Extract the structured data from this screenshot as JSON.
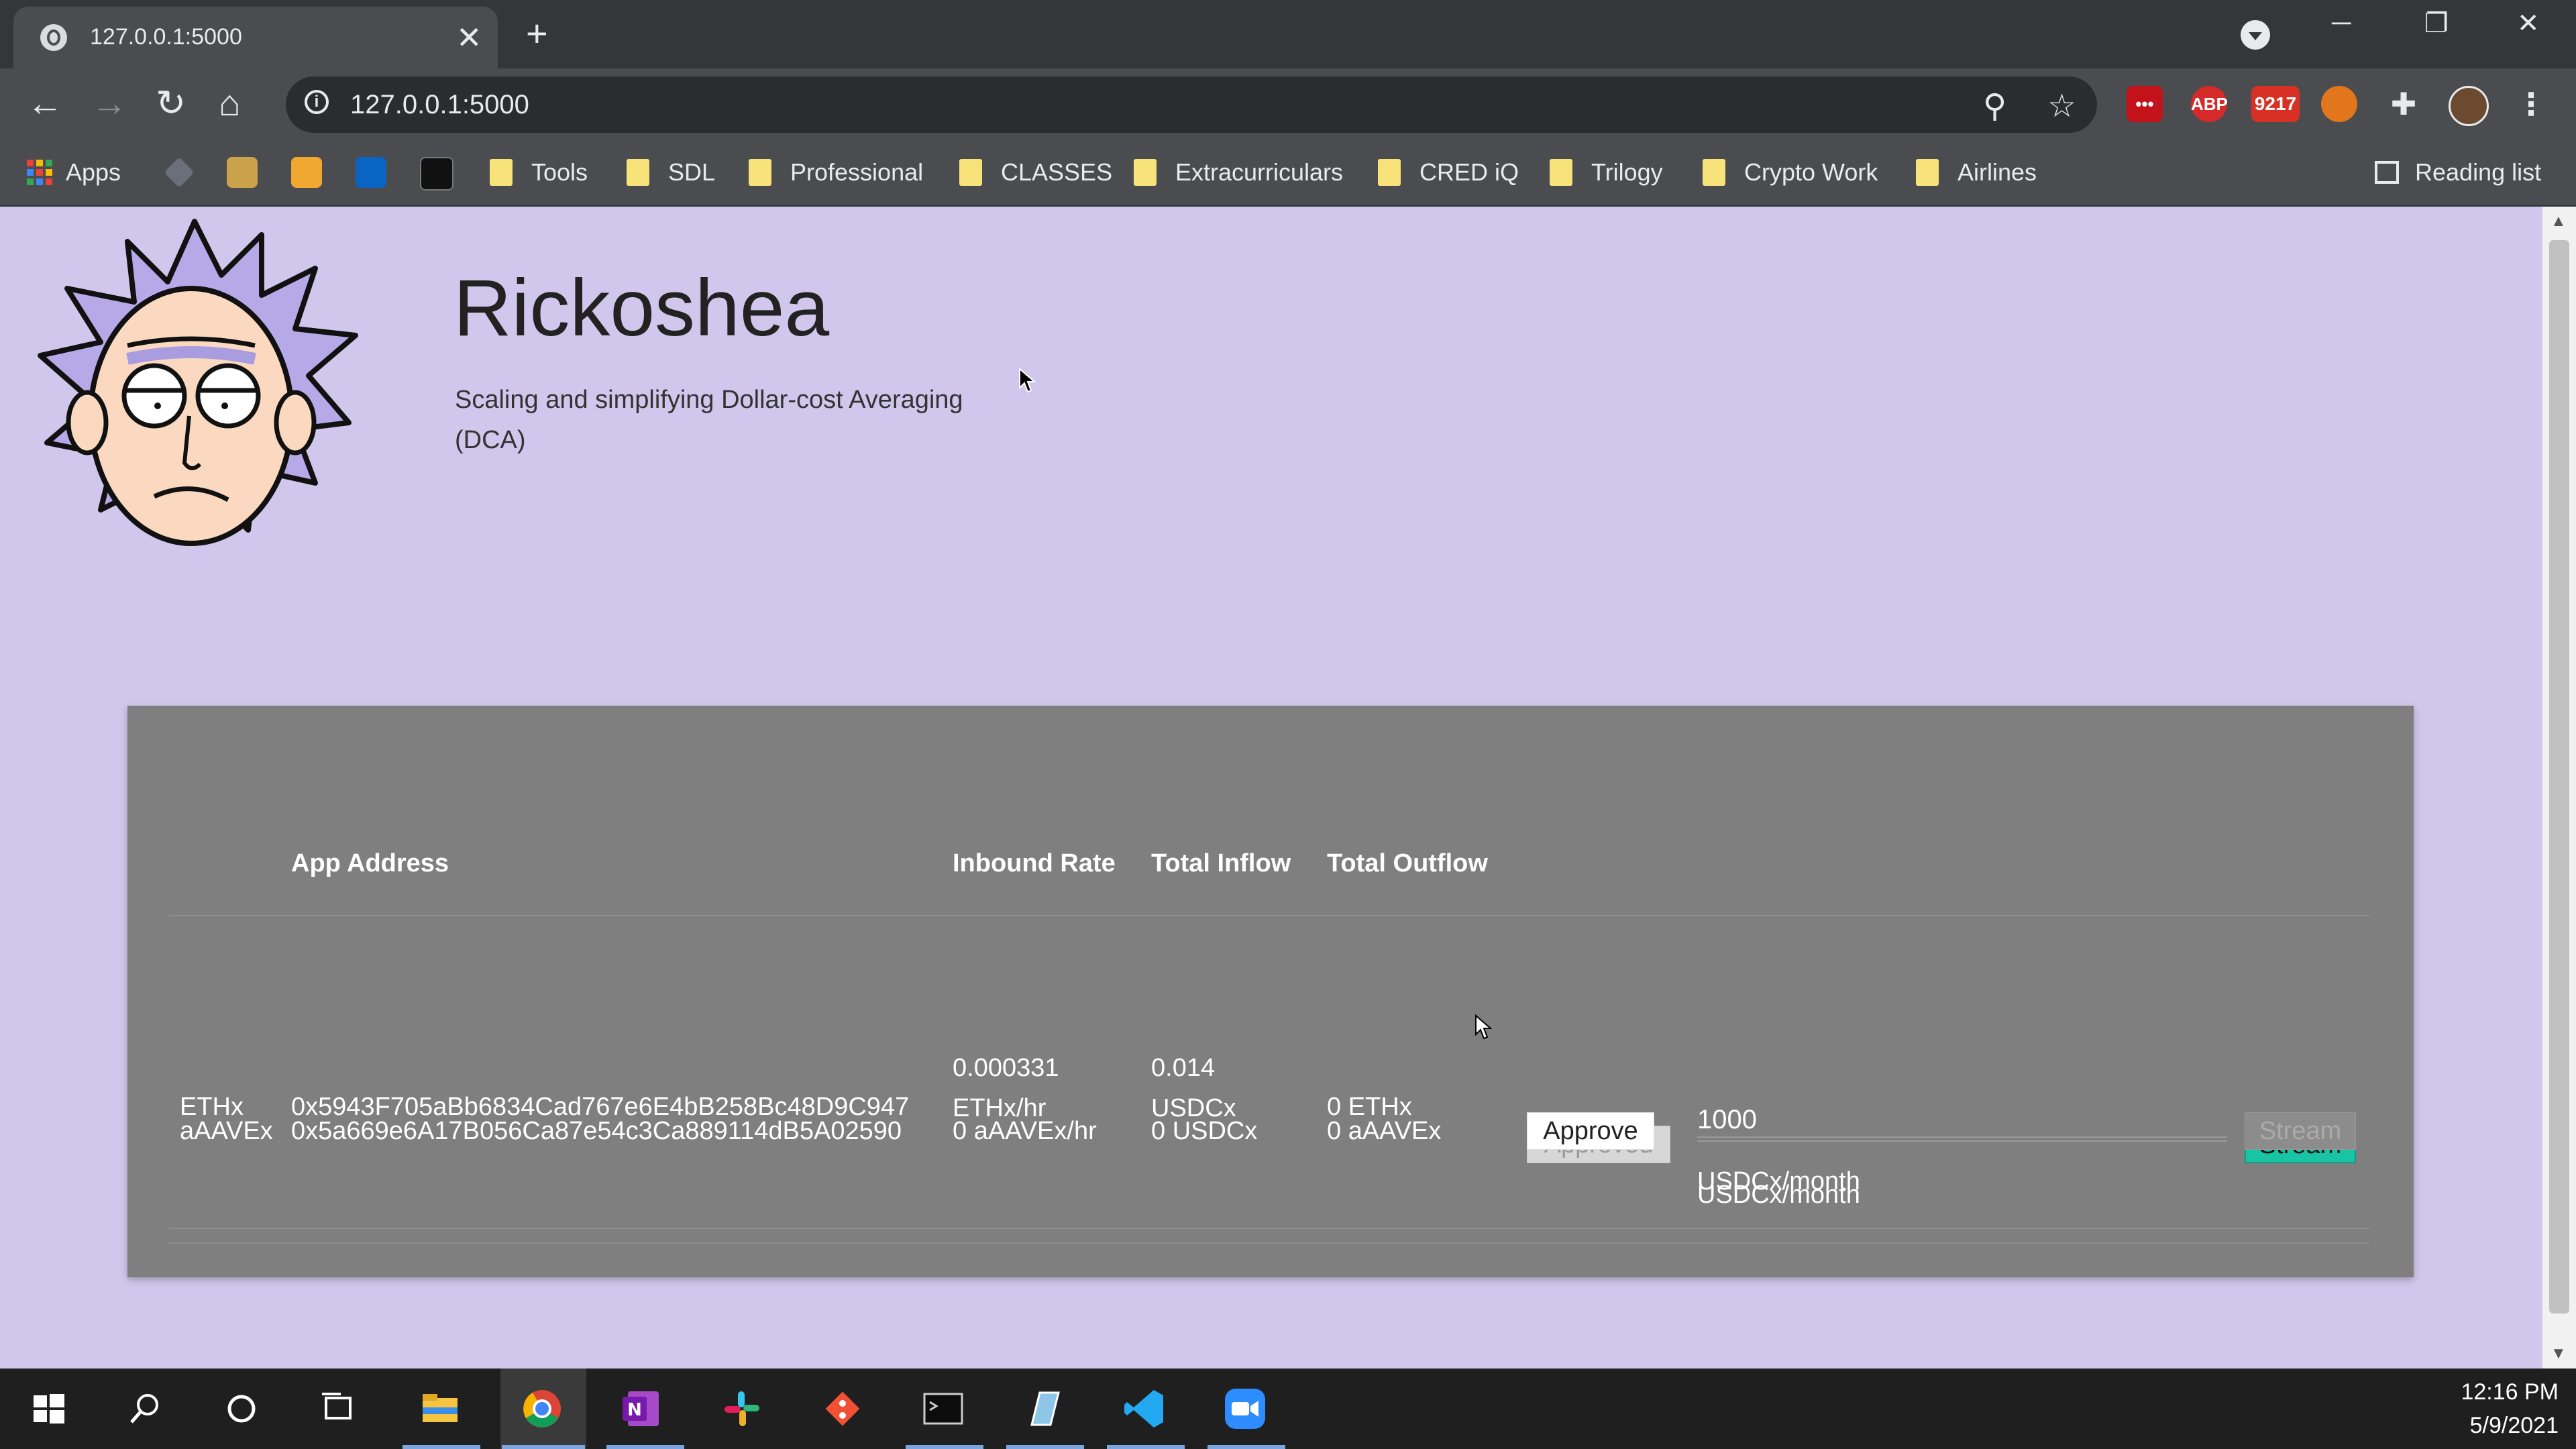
{
  "browser": {
    "tab_title": "127.0.0.1:5000",
    "tab_close": "✕",
    "new_tab": "+",
    "url": "127.0.0.1:5000",
    "window_controls": {
      "minimize": "─",
      "restore": "❐",
      "close": "✕"
    },
    "extensions": {
      "abp": "ABP",
      "mail_count": "9217"
    },
    "bookmarks": {
      "apps": "Apps",
      "folders": [
        "Tools",
        "SDL",
        "Professional",
        "CLASSES",
        "Extracurriculars",
        "CRED iQ",
        "Trilogy",
        "Crypto Work",
        "Airlines"
      ],
      "reading_list": "Reading list"
    }
  },
  "page": {
    "title": "Rickoshea",
    "subtitle": "Scaling and simplifying Dollar-cost Averaging (DCA)",
    "table": {
      "headers": [
        "App Address",
        "Inbound Rate",
        "Total Inflow",
        "Total Outflow"
      ],
      "rows": [
        {
          "token": "ETHx",
          "address": "0x5943F705aBb6834Cad767e6E4bB258Bc48D9C947",
          "inbound_rate": "0.000331 ETHx/hr",
          "total_inflow": "0.014 USDCx",
          "total_outflow": "0 ETHx",
          "approve_label": "Approved",
          "amount": "1000",
          "unit": "USDCx/month",
          "stream_label": "Stream"
        },
        {
          "token": "aAAVEx",
          "address": "0x5a669e6A17B056Ca87e54c3Ca889114dB5A02590",
          "inbound_rate": "0 aAAVEx/hr",
          "total_inflow": "0 USDCx",
          "total_outflow": "0 aAAVEx",
          "approve_label": "Approve",
          "amount": "",
          "unit": "USDCx/month",
          "stream_label": "Stream"
        }
      ]
    }
  },
  "taskbar": {
    "time": "12:16 PM",
    "date": "5/9/2021"
  },
  "colors": {
    "page_background": "#d1c7ec",
    "panel_background": "#7f7f7f",
    "stream_button": "#18c4a3"
  }
}
